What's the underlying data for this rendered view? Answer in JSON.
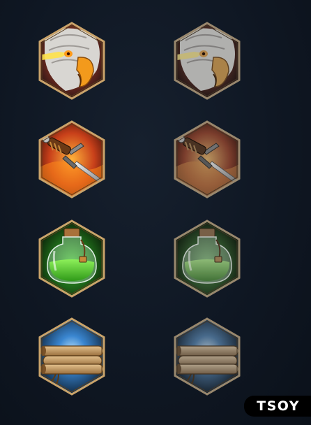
{
  "icons": [
    {
      "row": 0,
      "variant": "active",
      "name": "eagle-icon"
    },
    {
      "row": 0,
      "variant": "muted",
      "name": "eagle-icon"
    },
    {
      "row": 1,
      "variant": "active",
      "name": "dagger-icon"
    },
    {
      "row": 1,
      "variant": "muted",
      "name": "dagger-icon"
    },
    {
      "row": 2,
      "variant": "active",
      "name": "potion-icon"
    },
    {
      "row": 2,
      "variant": "muted",
      "name": "potion-icon"
    },
    {
      "row": 3,
      "variant": "active",
      "name": "scroll-icon"
    },
    {
      "row": 3,
      "variant": "muted",
      "name": "scroll-icon"
    }
  ],
  "colors": {
    "frame_gold": "#c9a36a",
    "background": "#0f1723",
    "eagle_bg": "#6b2a1f",
    "dagger_bg": "#c8401a",
    "potion_bg": "#1f6a1a",
    "scroll_bg": "#1d4f8a"
  },
  "brand": {
    "label": "TSOY"
  }
}
